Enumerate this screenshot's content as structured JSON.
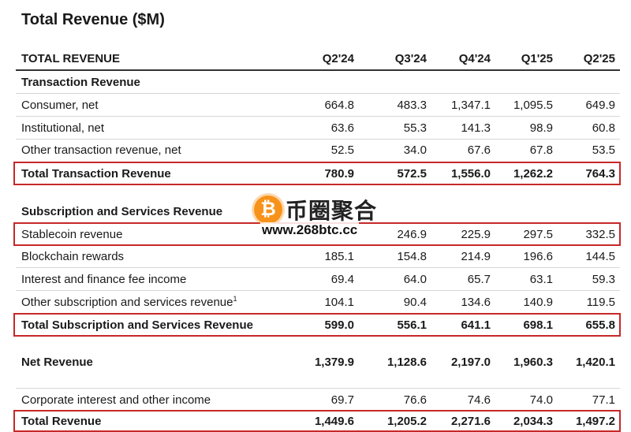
{
  "title": "Total Revenue ($M)",
  "header": {
    "label": "TOTAL REVENUE",
    "columns": [
      "Q2'24",
      "Q3'24",
      "Q4'24",
      "Q1'25",
      "Q2'25"
    ]
  },
  "sections": {
    "transaction": {
      "heading": "Transaction Revenue",
      "rows": [
        {
          "label": "Consumer, net",
          "values": [
            "664.8",
            "483.3",
            "1,347.1",
            "1,095.5",
            "649.9"
          ]
        },
        {
          "label": "Institutional, net",
          "values": [
            "63.6",
            "55.3",
            "141.3",
            "98.9",
            "60.8"
          ]
        },
        {
          "label": "Other transaction revenue, net",
          "values": [
            "52.5",
            "34.0",
            "67.6",
            "67.8",
            "53.5"
          ]
        }
      ],
      "total": {
        "label": "Total Transaction Revenue",
        "values": [
          "780.9",
          "572.5",
          "1,556.0",
          "1,262.2",
          "764.3"
        ]
      }
    },
    "subscription": {
      "heading": "Subscription and Services Revenue",
      "rows": [
        {
          "label": "Stablecoin revenue",
          "values": [
            "",
            "246.9",
            "225.9",
            "297.5",
            "332.5"
          ]
        },
        {
          "label": "Blockchain rewards",
          "values": [
            "185.1",
            "154.8",
            "214.9",
            "196.6",
            "144.5"
          ]
        },
        {
          "label": "Interest and finance fee income",
          "values": [
            "69.4",
            "64.0",
            "65.7",
            "63.1",
            "59.3"
          ]
        },
        {
          "label": "Other subscription and services revenue",
          "footnote": "1",
          "values": [
            "104.1",
            "90.4",
            "134.6",
            "140.9",
            "119.5"
          ]
        }
      ],
      "total": {
        "label": "Total Subscription and Services Revenue",
        "values": [
          "599.0",
          "556.1",
          "641.1",
          "698.1",
          "655.8"
        ]
      }
    }
  },
  "net_revenue": {
    "label": "Net Revenue",
    "values": [
      "1,379.9",
      "1,128.6",
      "2,197.0",
      "1,960.3",
      "1,420.1"
    ]
  },
  "corporate": {
    "label": "Corporate interest and other income",
    "values": [
      "69.7",
      "76.6",
      "74.6",
      "74.0",
      "77.1"
    ]
  },
  "total_revenue": {
    "label": "Total Revenue",
    "values": [
      "1,449.6",
      "1,205.2",
      "2,271.6",
      "2,034.3",
      "1,497.2"
    ]
  },
  "watermark": {
    "coin_glyph": "₿",
    "brand": "币圈聚合",
    "url": "www.268btc.cc"
  },
  "colors": {
    "highlight": "#c62828",
    "coin": "#f7931a"
  }
}
